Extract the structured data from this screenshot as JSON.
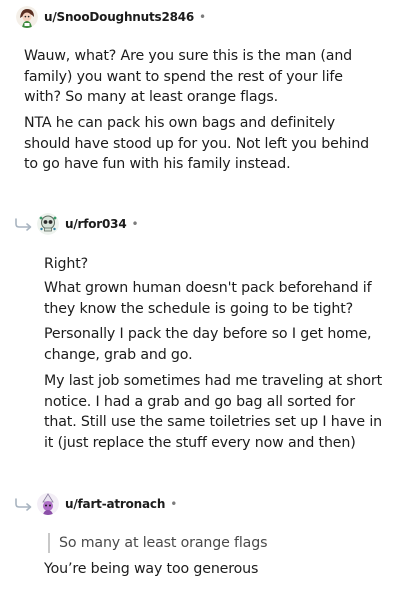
{
  "comments": [
    {
      "username": "u/SnooDoughnuts2846",
      "avatar_icon": "snoo-avatar-icon",
      "separator": "•",
      "paragraphs": [
        "Wauw, what? Are you sure this is the man (and family) you want to spend the rest of your life with? So many at least orange flags.",
        "NTA he can pack his own bags and definitely should have stood up for you. Not left you behind to go have fun with his family instead."
      ]
    },
    {
      "username": "u/rfor034",
      "avatar_icon": "skull-avatar-icon",
      "separator": "•",
      "paragraphs": [
        "Right?",
        "What grown human doesn't pack beforehand if they know the schedule is going to be tight?",
        "Personally I pack the day before so I get home, change, grab and go.",
        "My last job sometimes had me traveling at short notice. I had a grab and go bag all sorted for that. Still use the same toiletries set up I have in it (just replace the stuff every now and then)"
      ]
    },
    {
      "username": "u/fart-atronach",
      "avatar_icon": "wizard-avatar-icon",
      "separator": "•",
      "quote": "So many at least orange flags",
      "paragraphs": [
        "You’re being way too generous"
      ]
    }
  ],
  "colors": {
    "text": "#1c1c1c",
    "meta": "#7c7c7c",
    "quote_bar": "#c8c8c8",
    "reply_arrow": "#a8b4c0"
  }
}
